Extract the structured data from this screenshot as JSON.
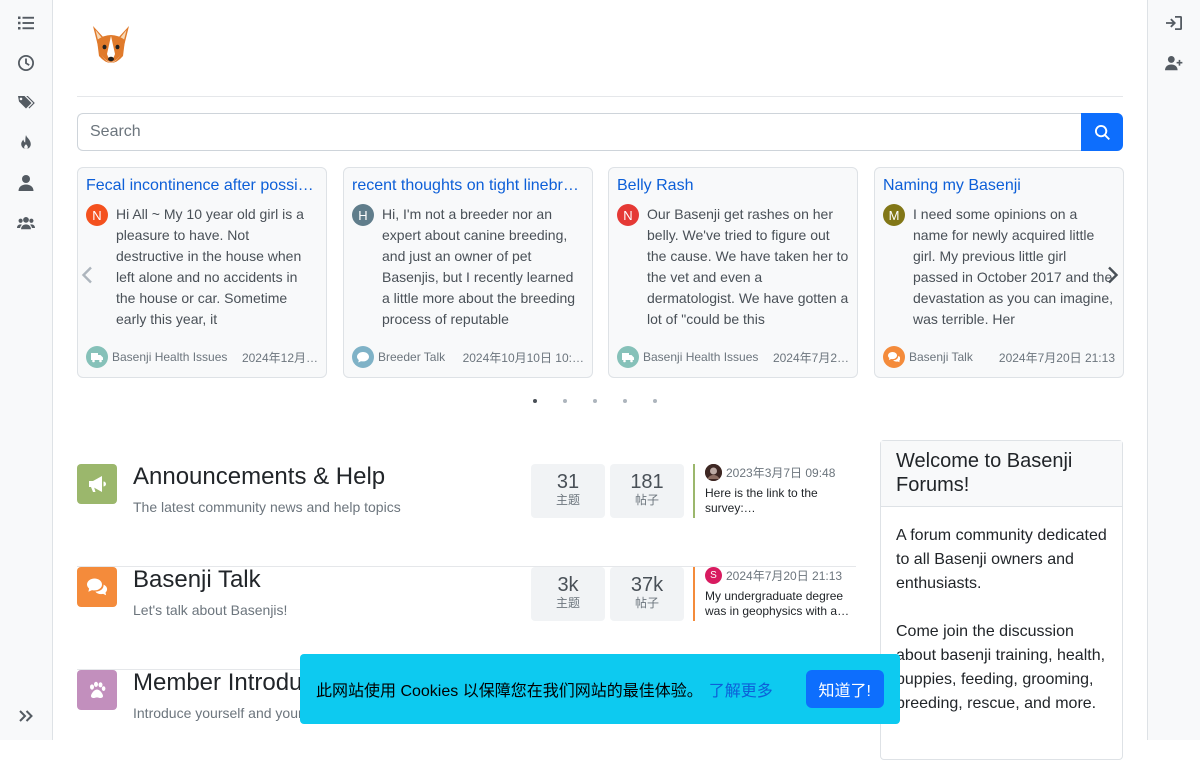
{
  "left_nav": [
    {
      "name": "categories",
      "icon": "list-icon"
    },
    {
      "name": "recent",
      "icon": "clock-icon"
    },
    {
      "name": "tags",
      "icon": "tags-icon"
    },
    {
      "name": "popular",
      "icon": "fire-icon"
    },
    {
      "name": "users",
      "icon": "user-icon"
    },
    {
      "name": "groups",
      "icon": "users-icon"
    }
  ],
  "search": {
    "placeholder": "Search"
  },
  "carousel": {
    "cards": [
      {
        "title": "Fecal incontinence after possible stroke",
        "avatar_letter": "N",
        "avatar_color": "#f4511e",
        "excerpt": "Hi All ~ My 10 year old girl is a pleasure to have. Not destructive in the house when left alone and no accidents in the house or car. Sometime early this year, it",
        "category": "Basenji Health Issues",
        "category_color": "#86c1b9",
        "time": "2024年12月…"
      },
      {
        "title": "recent thoughts on tight linebreeding",
        "avatar_letter": "H",
        "avatar_color": "#607d8b",
        "excerpt": "Hi, I'm not a breeder nor an expert about canine breeding, and just an owner of pet Basenjis, but I recently learned a little more about the breeding process of reputable",
        "category": "Breeder Talk",
        "category_color": "#7fb2c7",
        "time": "2024年10月10日 10:…"
      },
      {
        "title": "Belly Rash",
        "avatar_letter": "N",
        "avatar_color": "#e53935",
        "excerpt": "Our Basenji get rashes on her belly. We've tried to figure out the cause. We have taken her to the vet and even a dermatologist. We have gotten a lot of \"could be this",
        "category": "Basenji Health Issues",
        "category_color": "#86c1b9",
        "time": "2024年7月2…"
      },
      {
        "title": "Naming my Basenji",
        "avatar_letter": "M",
        "avatar_color": "#827717",
        "excerpt": "I need some opinions on a name for newly acquired little girl. My previous little girl passed in October 2017 and the devastation as you can imagine, was terrible. Her",
        "category": "Basenji Talk",
        "category_color": "#f48b3b",
        "time": "2024年7月20日 21:13"
      }
    ]
  },
  "categories": [
    {
      "title": "Announcements & Help",
      "description": "The latest community news and help topics",
      "icon": "bullhorn-icon",
      "color": "#9bb76c",
      "topics": "31",
      "posts": "181",
      "topics_label": "主题",
      "posts_label": "帖子",
      "last_post": {
        "avatar_letter": "",
        "avatar_color": "#5d4037",
        "time": "2023年3月7日 09:48",
        "text": "Here is the link to the survey:…"
      }
    },
    {
      "title": "Basenji Talk",
      "description": "Let's talk about Basenjis!",
      "icon": "comments-icon",
      "color": "#f48b3b",
      "topics": "3k",
      "posts": "37k",
      "topics_label": "主题",
      "posts_label": "帖子",
      "last_post": {
        "avatar_letter": "S",
        "avatar_color": "#d81b60",
        "time": "2024年7月20日 21:13",
        "text": "My undergraduate degree was in geophysics with a…"
      }
    },
    {
      "title": "Member Introductions",
      "description": "Introduce yourself and your Basenjis",
      "icon": "paw-icon",
      "color": "#c28fbd"
    }
  ],
  "widget": {
    "title": "Welcome to Basenji Forums!",
    "paragraphs": [
      "A forum community dedicated to all Basenji owners and enthusiasts.",
      "Come join the discussion about basenji training, health, puppies, feeding, grooming, breeding, rescue, and more."
    ]
  },
  "cookie": {
    "message": "此网站使用 Cookies 以保障您在我们网站的最佳体验。",
    "learn_more": "了解更多",
    "accept": "知道了!"
  },
  "colors": {
    "primary": "#0d6efd",
    "info": "#0dcaf0",
    "link": "#0d5fd8"
  }
}
